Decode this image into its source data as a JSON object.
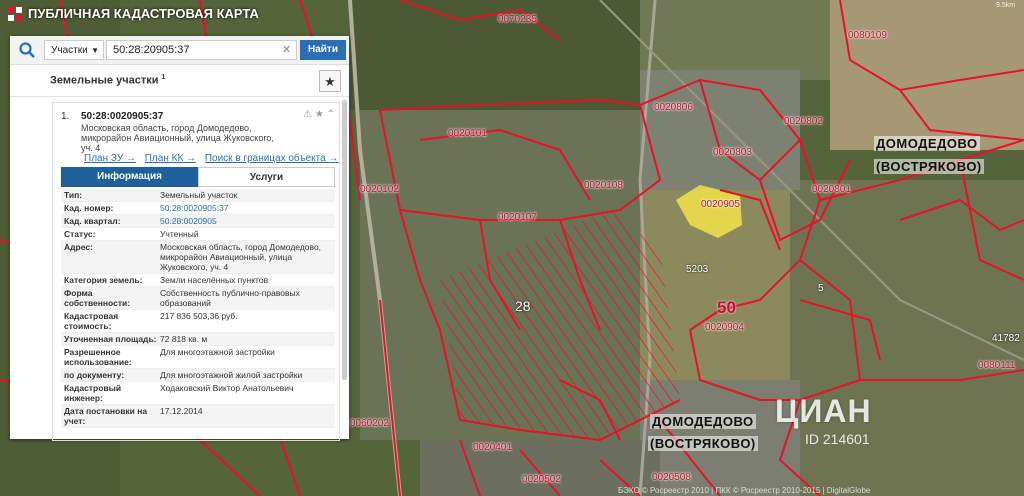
{
  "app": {
    "title": "ПУБЛИЧНАЯ КАДАСТРОВАЯ КАРТА"
  },
  "search": {
    "type_label": "Участки",
    "query": "50:28:20905:37",
    "button_label": "Найти"
  },
  "lots_panel": {
    "title": "Земельные участки",
    "count_sup": "1"
  },
  "card": {
    "index": "1.",
    "cad_number": "50:28:0020905:37",
    "address": "Московская область, город Домодедово, микрорайон Авиационный, улица Жуковского, уч. 4",
    "links": [
      "План ЗУ →",
      "План КК →",
      "Поиск в границах объекта →"
    ],
    "tabs": {
      "info": "Информация",
      "services": "Услуги"
    },
    "rows": [
      {
        "k": "Тип:",
        "v": "Земельный участок"
      },
      {
        "k": "Кад. номер:",
        "v": "50:28:0020905:37",
        "link": true
      },
      {
        "k": "Кад. квартал:",
        "v": "50:28:0020905",
        "link": true
      },
      {
        "k": "Статус:",
        "v": "Учтенный"
      },
      {
        "k": "Адрес:",
        "v": "Московская область, город Домодедово, микрорайон Авиационный, улица Жуковского, уч. 4"
      },
      {
        "k": "Категория земель:",
        "v": "Земли населённых пунктов"
      },
      {
        "k": "Форма собственности:",
        "v": "Собственность публично-правовых образований"
      },
      {
        "k": "Кадастровая стоимость:",
        "v": "217 836 503,36 руб."
      },
      {
        "k": "Уточненная площадь:",
        "v": "72 818 кв. м"
      },
      {
        "k": "Разрешенное использование:",
        "v": "Для многоэтажной застройки"
      },
      {
        "k": "по документу:",
        "v": "Для многоэтажной жилой застройки"
      },
      {
        "k": "Кадастровый инженер:",
        "v": "Ходаковский Виктор Анатольевич"
      },
      {
        "k": "Дата постановки на учет:",
        "v": "17.12.2014"
      }
    ]
  },
  "map_labels": [
    "0070235",
    "0020101",
    "0020102",
    "0020107",
    "0020108",
    "0020806",
    "0020802",
    "0020803",
    "0020905",
    "0020904",
    "0020801",
    "0020401",
    "0020502",
    "0020508",
    "0060202",
    "0080109",
    "0080111",
    "28",
    "5203",
    "5",
    "41782"
  ],
  "towns": [
    "ДОМОДЕДОВО",
    "(ВОСТРЯКОВО)",
    "ДОМОДЕДОВО",
    "(ВОСТРЯКОВО)"
  ],
  "zoom_badge": "50",
  "watermark": {
    "logo": "ЦИАН",
    "id": "ID 214601"
  },
  "copyright": "БЭКО © Росреестр 2010 | ПКК © Росреестр 2010-2015 | DigitalGlobe",
  "corner_text": "9.5km",
  "colors": {
    "boundary": "#e8102a",
    "highlight": "#f2e34a",
    "accent": "#2a6fb5",
    "tab_active": "#1f5f9c"
  }
}
